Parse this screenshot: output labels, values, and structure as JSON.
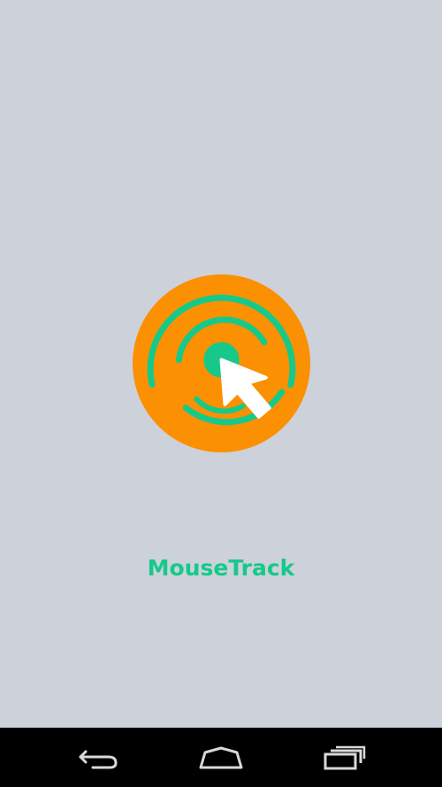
{
  "app": {
    "name": "MouseTrack"
  },
  "colors": {
    "background": "#cdd1da",
    "accent_orange": "#fb9002",
    "accent_green": "#16c98a",
    "cursor": "#ffffff",
    "navbar": "#000000",
    "nav_icon": "#d9d9d9"
  },
  "logo": {
    "icon": "mouse-cursor-target-icon"
  },
  "navigation_bar": {
    "back_icon": "back-arrow-icon",
    "home_icon": "home-icon",
    "recents_icon": "recent-apps-icon"
  }
}
